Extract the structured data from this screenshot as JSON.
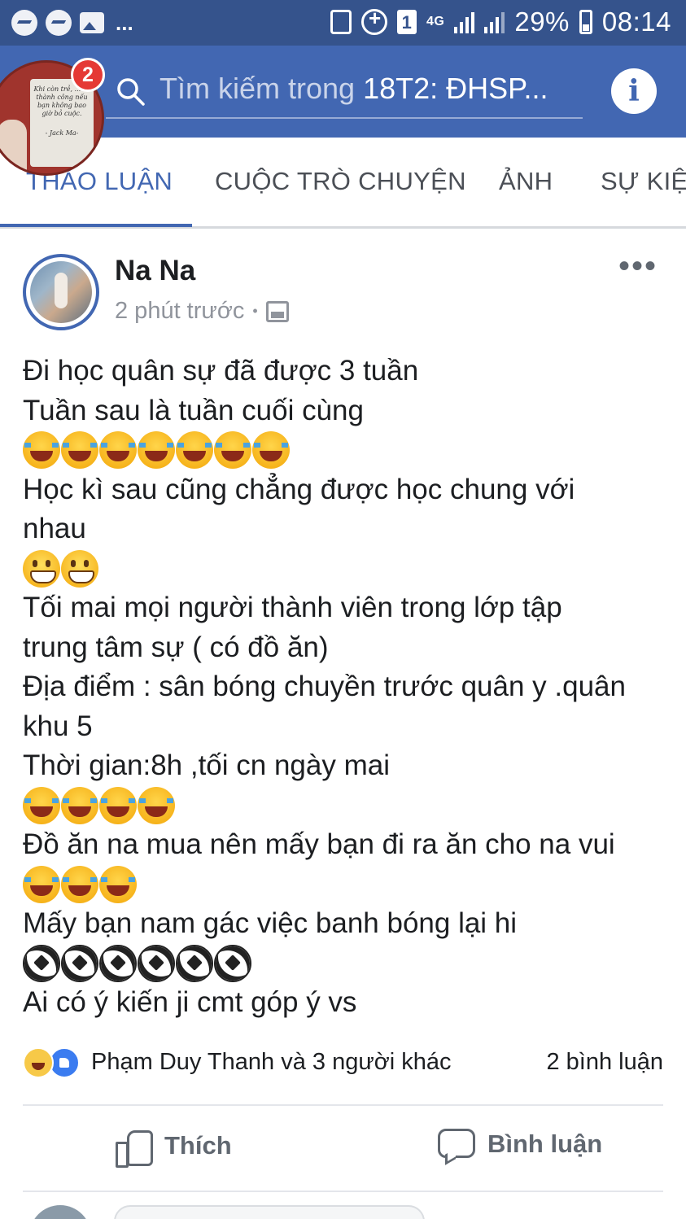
{
  "status_bar": {
    "battery": "29%",
    "time": "08:14",
    "network": "4G",
    "sim_slot": "1",
    "more": "..."
  },
  "header": {
    "search_prefix": "Tìm kiếm trong ",
    "search_group": "18T2: ĐHSP...",
    "info_label": "i",
    "notification_count": "2",
    "group_cover_quote": "Khi còn trẻ, ... sẽ thành công nếu bạn không bao giờ bỏ cuộc.",
    "group_cover_author": "- Jack Ma-"
  },
  "tabs": [
    {
      "label": "THẢO LUẬN",
      "active": true
    },
    {
      "label": "CUỘC TRÒ CHUYỆN",
      "active": false
    },
    {
      "label": "ẢNH",
      "active": false
    },
    {
      "label": "SỰ KIỆN",
      "active": false
    }
  ],
  "post": {
    "author": "Na Na",
    "time": "2 phút trước",
    "separator": "•",
    "more": "•••",
    "lines": [
      {
        "type": "text",
        "text": "Đi học quân sự đã được 3 tuần"
      },
      {
        "type": "text",
        "text": "Tuần sau là tuần cuối cùng"
      },
      {
        "type": "emoji",
        "emoji": "laugh",
        "count": 7
      },
      {
        "type": "text",
        "text": "Học kì sau cũng chẳng được học chung với"
      },
      {
        "type": "text",
        "text": "nhau"
      },
      {
        "type": "emoji",
        "emoji": "grin",
        "count": 2
      },
      {
        "type": "text",
        "text": "Tối mai mọi người thành viên trong lớp tập"
      },
      {
        "type": "text",
        "text": "trung tâm sự ( có đồ ăn)"
      },
      {
        "type": "text",
        "text": "Địa điểm : sân bóng chuyền trước quân y .quân"
      },
      {
        "type": "text",
        "text": "khu 5"
      },
      {
        "type": "text",
        "text": "Thời gian:8h  ,tối cn ngày mai"
      },
      {
        "type": "emoji",
        "emoji": "laugh",
        "count": 4
      },
      {
        "type": "text",
        "text": "Đồ ăn na mua nên mấy bạn đi ra ăn cho na  vui"
      },
      {
        "type": "emoji",
        "emoji": "laugh",
        "count": 3
      },
      {
        "type": "text",
        "text": "Mấy bạn nam gác việc banh bóng lại hi"
      },
      {
        "type": "emoji",
        "emoji": "ball",
        "count": 6
      },
      {
        "type": "text",
        "text": "Ai có ý kiến ji cmt góp ý vs"
      }
    ],
    "reactions_text": "Phạm Duy Thanh và 3 người khác",
    "comments_count": "2 bình luận",
    "like_label": "Thích",
    "comment_label": "Bình luận"
  }
}
